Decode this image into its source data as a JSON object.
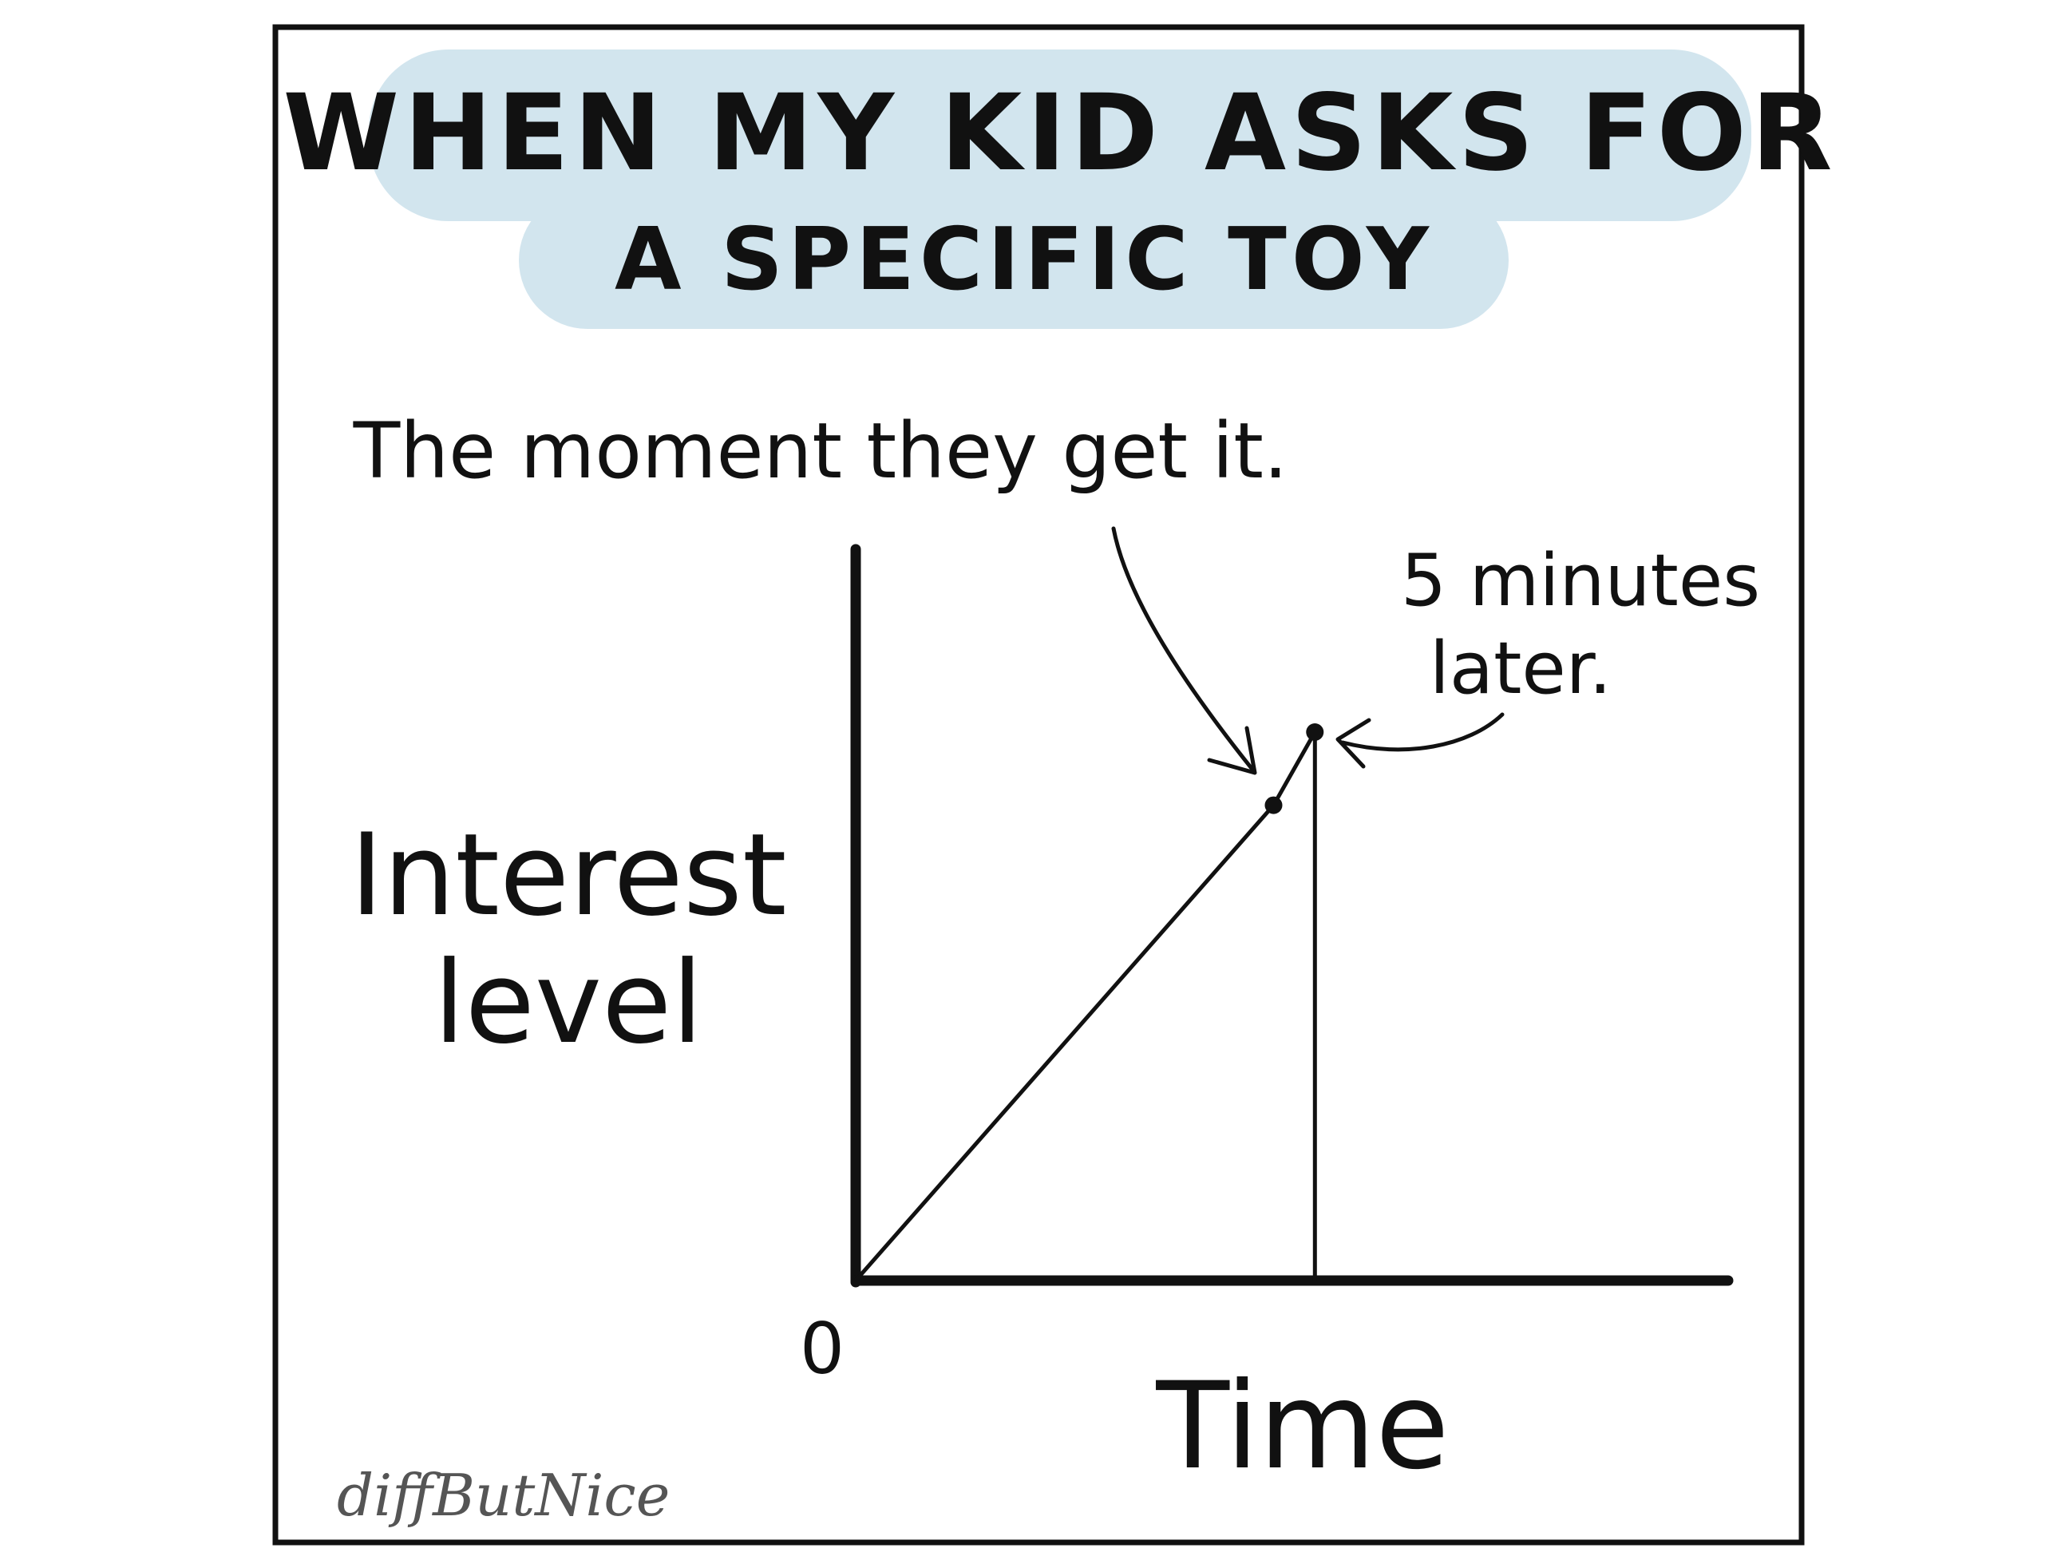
{
  "comic": {
    "title_line1": "WHEN MY KID ASKS FOR",
    "title_line2": "A SPECIFIC TOY",
    "signature": "diffButNice",
    "title_highlight_color": "#d2e5ee"
  },
  "chart_data": {
    "type": "line",
    "title": "WHEN MY KID ASKS FOR A SPECIFIC TOY",
    "xlabel": "Time",
    "ylabel_line1": "Interest",
    "ylabel_line2": "level",
    "origin_label": "0",
    "series": [
      {
        "points": [
          {
            "x": 0,
            "y": 0
          },
          {
            "x": 0.91,
            "y": 0.65
          },
          {
            "x": 1.0,
            "y": 0.75
          },
          {
            "x": 1.0,
            "y": 0
          }
        ]
      }
    ],
    "xlim": [
      0,
      1.9
    ],
    "ylim": [
      0,
      1.0
    ],
    "annotations": [
      {
        "text": "The moment they get it.",
        "x": 0.91,
        "y": 0.65
      },
      {
        "text_line1": "5 minutes",
        "text_line2": "later.",
        "x": 1.0,
        "y": 0.75
      }
    ],
    "grid": false,
    "legend": "none"
  }
}
